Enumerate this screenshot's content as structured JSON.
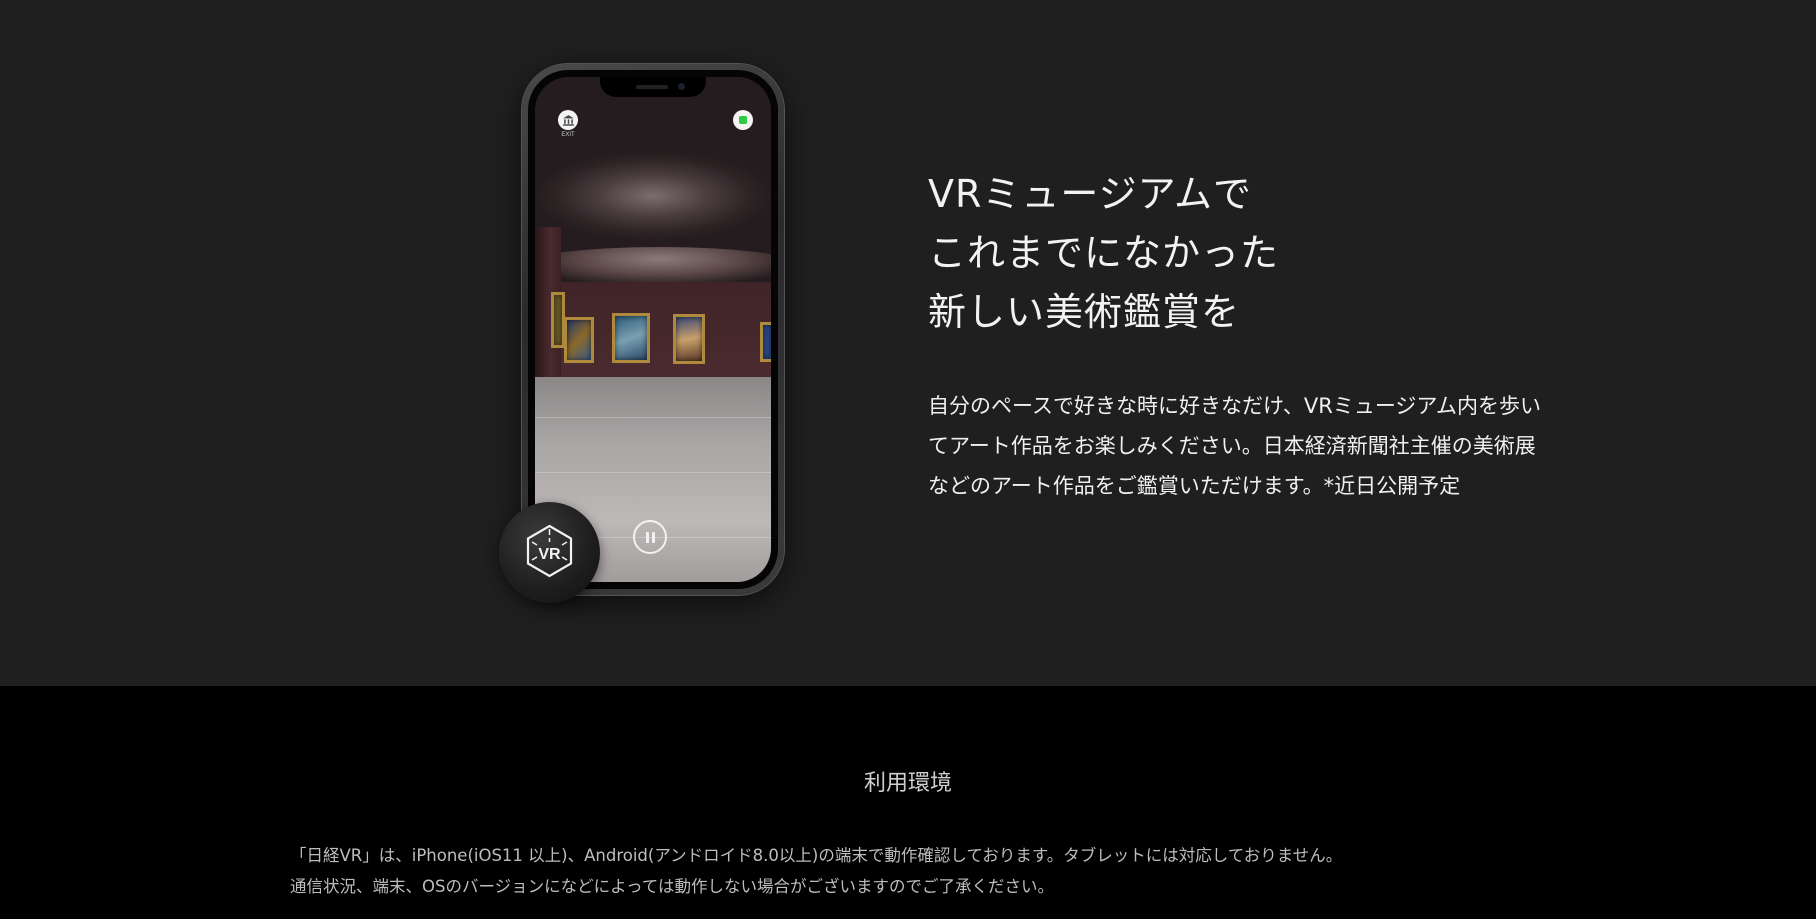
{
  "hero": {
    "headline": [
      "VRミュージアムで",
      "これまでになかった",
      "新しい美術鑑賞を"
    ],
    "body": "自分のペースで好きな時に好きなだけ、VRミュージアム内を歩いてアート作品をお楽しみください。日本経済新聞社主催の美術展などのアート作品をご鑑賞いただけます。*近日公開予定"
  },
  "phone": {
    "exit_label": "EXIT",
    "vr_badge_label": "VR",
    "icons": [
      "museum-icon",
      "record-indicator-icon",
      "pause-icon",
      "vr-cube-icon"
    ],
    "status_color": "#2ecc40"
  },
  "environment": {
    "title": "利用環境",
    "lines": [
      "「日経VR」は、iPhone(iOS11 以上)、Android(アンドロイド8.0以上)の端末で動作確認しております。タブレットには対応しておりません。",
      "通信状況、端末、OSのバージョンになどによっては動作しない場合がございますのでご了承ください。"
    ]
  },
  "colors": {
    "hero_bg": "#1f1f1f",
    "footer_bg": "#000000",
    "text_primary": "#f2f2f2",
    "text_secondary": "#bdbdbd"
  }
}
